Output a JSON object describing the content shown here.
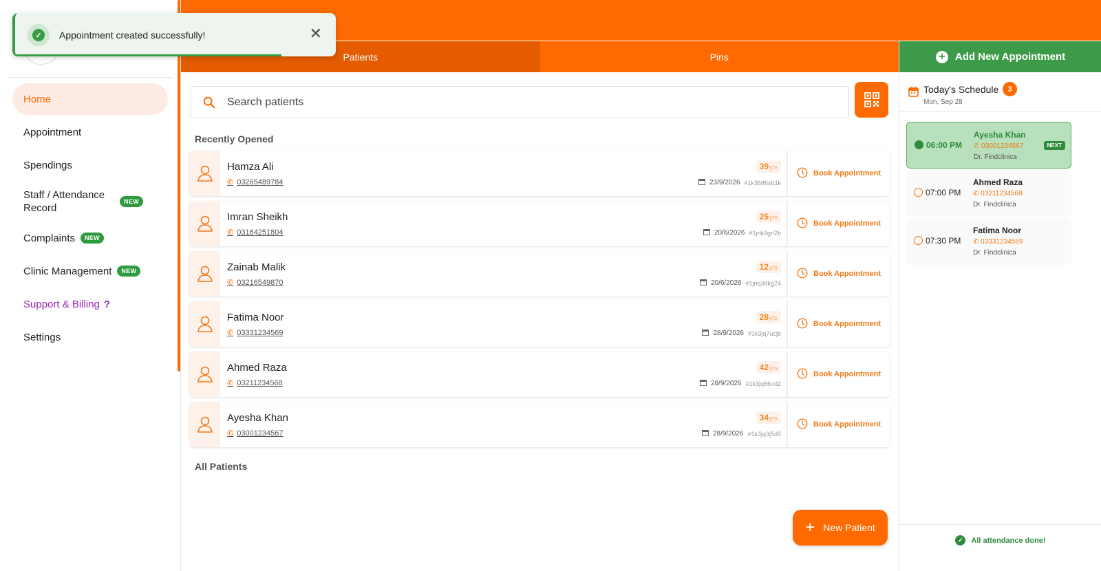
{
  "toast": {
    "message": "Appointment created successfully!",
    "close_label": "✕",
    "icon": "check-circle-icon",
    "progress": 0.83
  },
  "sidebar": {
    "items": [
      {
        "label": "Home",
        "active": true
      },
      {
        "label": "Appointment"
      },
      {
        "label": "Spendings"
      },
      {
        "label": "Staff / Attendance Record",
        "line1": "Staff / Attendance",
        "line2": "Record",
        "badge": "NEW"
      },
      {
        "label": "Complaints",
        "badge": "NEW"
      },
      {
        "label": "Clinic Management",
        "badge": "NEW"
      },
      {
        "label": "Support & Billing",
        "suffix": "?"
      },
      {
        "label": "Settings"
      }
    ]
  },
  "tabs": [
    {
      "label": "Patients",
      "active": true
    },
    {
      "label": "Pins"
    }
  ],
  "search": {
    "placeholder": "Search patients",
    "value": ""
  },
  "sections": {
    "recent": "Recently Opened",
    "all": "All Patients"
  },
  "patients": [
    {
      "name": "Hamza Ali",
      "phone": "03265489784",
      "age": "39",
      "age_unit": "yrs",
      "date": "23/9/2026",
      "id": "#1k36tf6sb1k",
      "action": "Book Appointment"
    },
    {
      "name": "Imran Sheikh",
      "phone": "03164251804",
      "age": "25",
      "age_unit": "yrs",
      "date": "20/6/2026",
      "id": "#1jrik9gri2b",
      "action": "Book Appointment"
    },
    {
      "name": "Zainab Malik",
      "phone": "03216549870",
      "age": "12",
      "age_unit": "yrs",
      "date": "20/6/2026",
      "id": "#1jriq3dkg24",
      "action": "Book Appointment"
    },
    {
      "name": "Fatima Noor",
      "phone": "03331234569",
      "age": "28",
      "age_unit": "yrs",
      "date": "28/9/2026",
      "id": "#1k3jq7ucjb",
      "action": "Book Appointment"
    },
    {
      "name": "Ahmed Raza",
      "phone": "03211234568",
      "age": "42",
      "age_unit": "yrs",
      "date": "28/9/2026",
      "id": "#1k3jq66nd2",
      "action": "Book Appointment"
    },
    {
      "name": "Ayesha Khan",
      "phone": "03001234567",
      "age": "34",
      "age_unit": "yrs",
      "date": "28/9/2026",
      "id": "#1k3jq3j5d5",
      "action": "Book Appointment"
    }
  ],
  "new_patient": {
    "label": "New Patient"
  },
  "right_panel": {
    "add_label": "Add New Appointment",
    "schedule_title": "Today's Schedule",
    "count": "3",
    "date": "Mon, Sep 28",
    "appointments": [
      {
        "time": "06:00 PM",
        "name": "Ayesha Khan",
        "phone": "03001234567",
        "doctor": "Dr. Findclinica",
        "next": true,
        "next_label": "NEXT"
      },
      {
        "time": "07:00 PM",
        "name": "Ahmed Raza",
        "phone": "03211234568",
        "doctor": "Dr. Findclinica"
      },
      {
        "time": "07:30 PM",
        "name": "Fatima Noor",
        "phone": "03331234569",
        "doctor": "Dr. Findclinica"
      }
    ],
    "footer": "All attendance done!"
  },
  "colors": {
    "brand": "#ff6a00",
    "success": "#3c9a48",
    "support": "#9c27b0"
  }
}
